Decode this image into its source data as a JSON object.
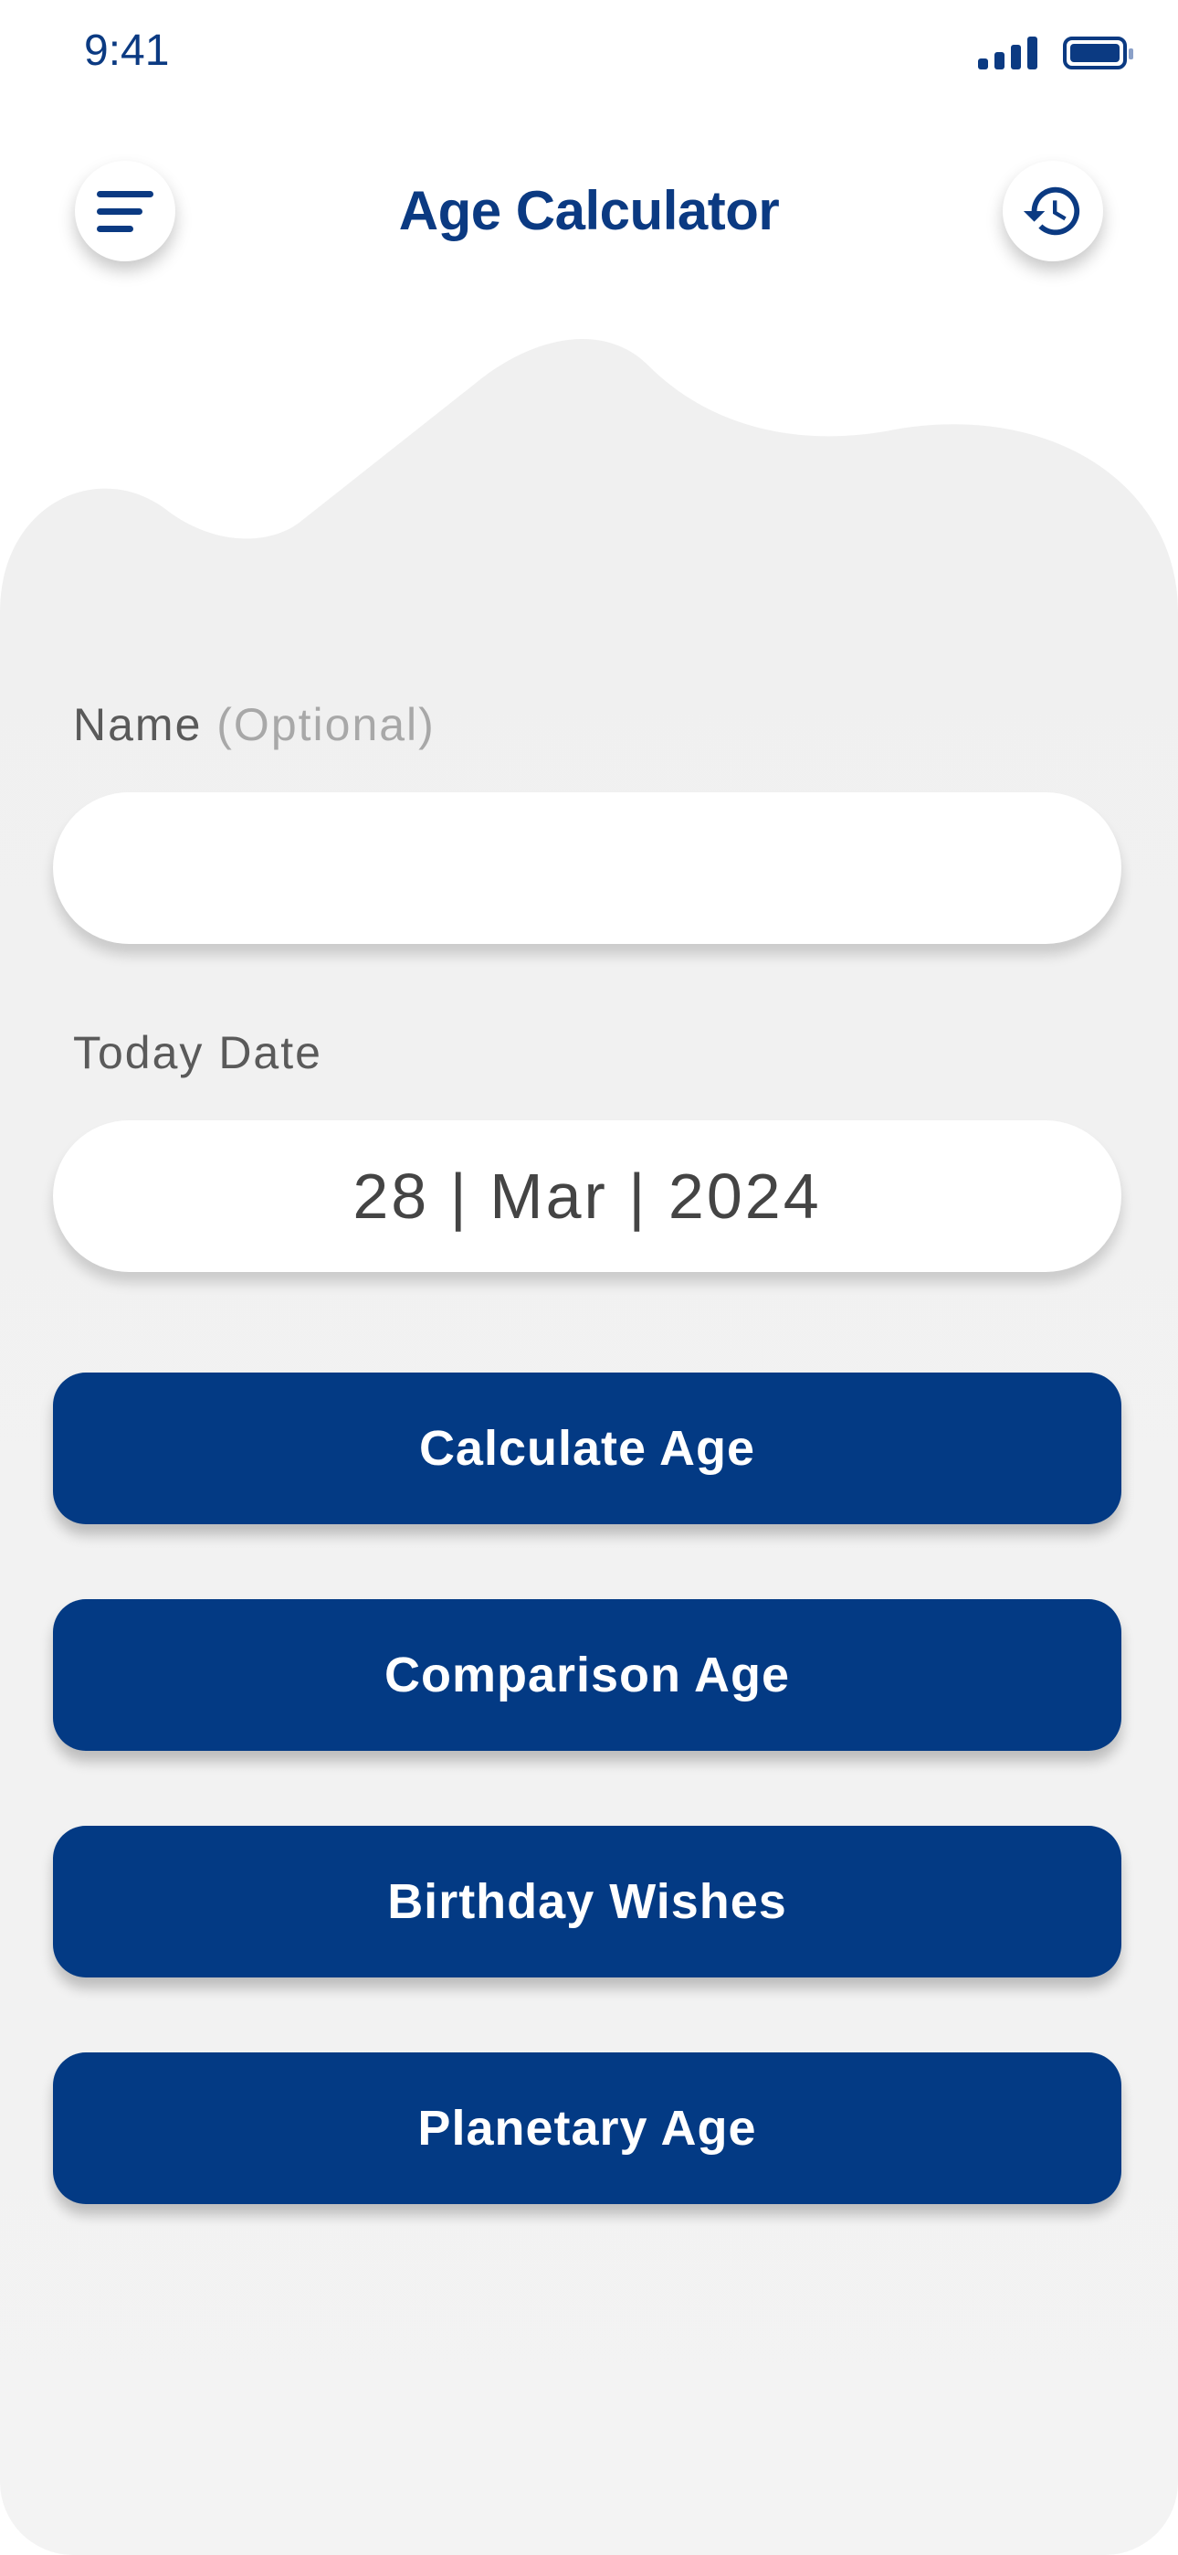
{
  "status_bar": {
    "time": "9:41"
  },
  "header": {
    "title": "Age Calculator"
  },
  "form": {
    "name_label": "Name",
    "name_optional": "(Optional)",
    "name_value": "",
    "date_label": "Today Date",
    "date_value": "28 | Mar | 2024"
  },
  "buttons": [
    {
      "label": "Calculate Age"
    },
    {
      "label": "Comparison Age"
    },
    {
      "label": "Birthday Wishes"
    },
    {
      "label": "Planetary Age"
    }
  ],
  "colors": {
    "primary": "#033a84",
    "background": "#f3f3f3"
  }
}
